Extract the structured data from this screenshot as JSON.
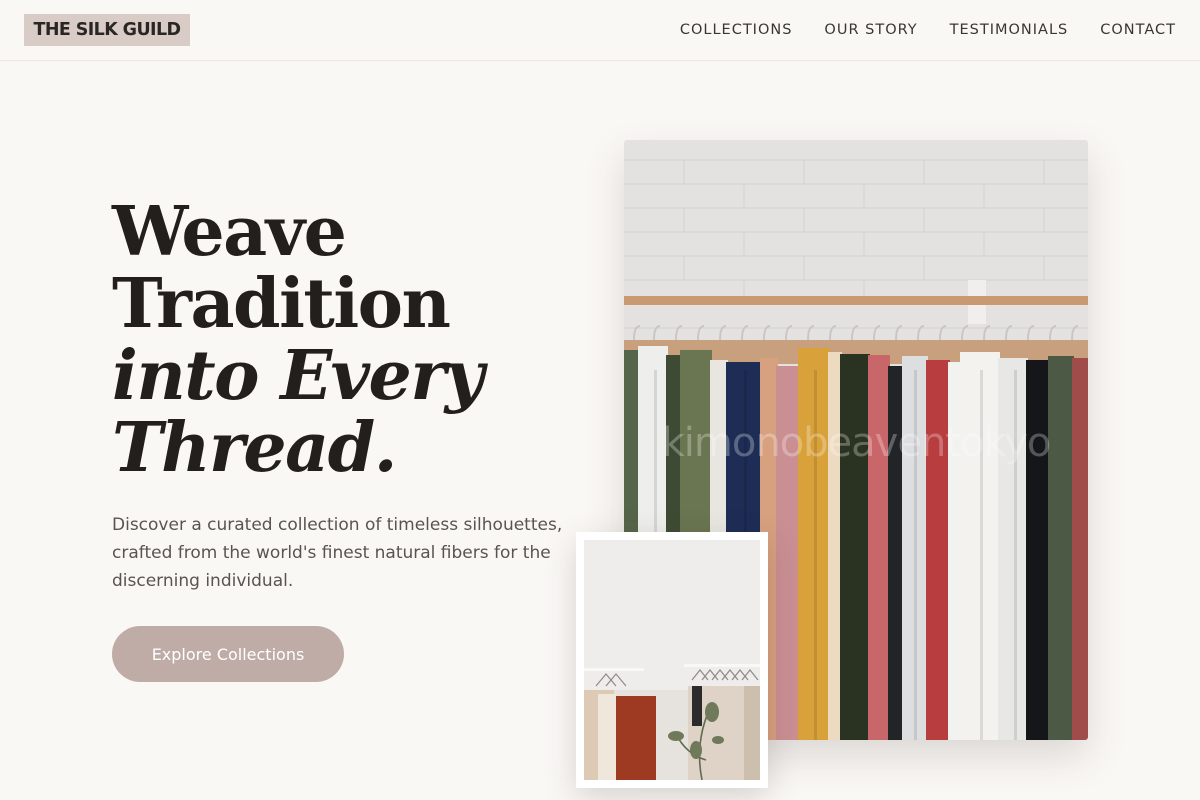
{
  "brand": {
    "logo_text": "THE SILK GUILD"
  },
  "nav": {
    "items": [
      {
        "label": "COLLECTIONS"
      },
      {
        "label": "OUR STORY"
      },
      {
        "label": "TESTIMONIALS"
      },
      {
        "label": "CONTACT"
      }
    ]
  },
  "hero": {
    "headline_line1": "Weave",
    "headline_line2": "Tradition",
    "headline_line3": "into Every",
    "headline_line4": "Thread.",
    "description": "Discover a curated collection of timeless silhouettes, crafted from the world's finest natural fibers for the discerning individual.",
    "cta_label": "Explore Collections"
  },
  "images": {
    "main_watermark": "kimonobeaventokyo"
  },
  "colors": {
    "background": "#faf8f5",
    "logo_bg": "#d9cbc6",
    "cta_bg": "#bfaca7",
    "text_dark": "#221f1d",
    "text_muted": "#59544f"
  }
}
